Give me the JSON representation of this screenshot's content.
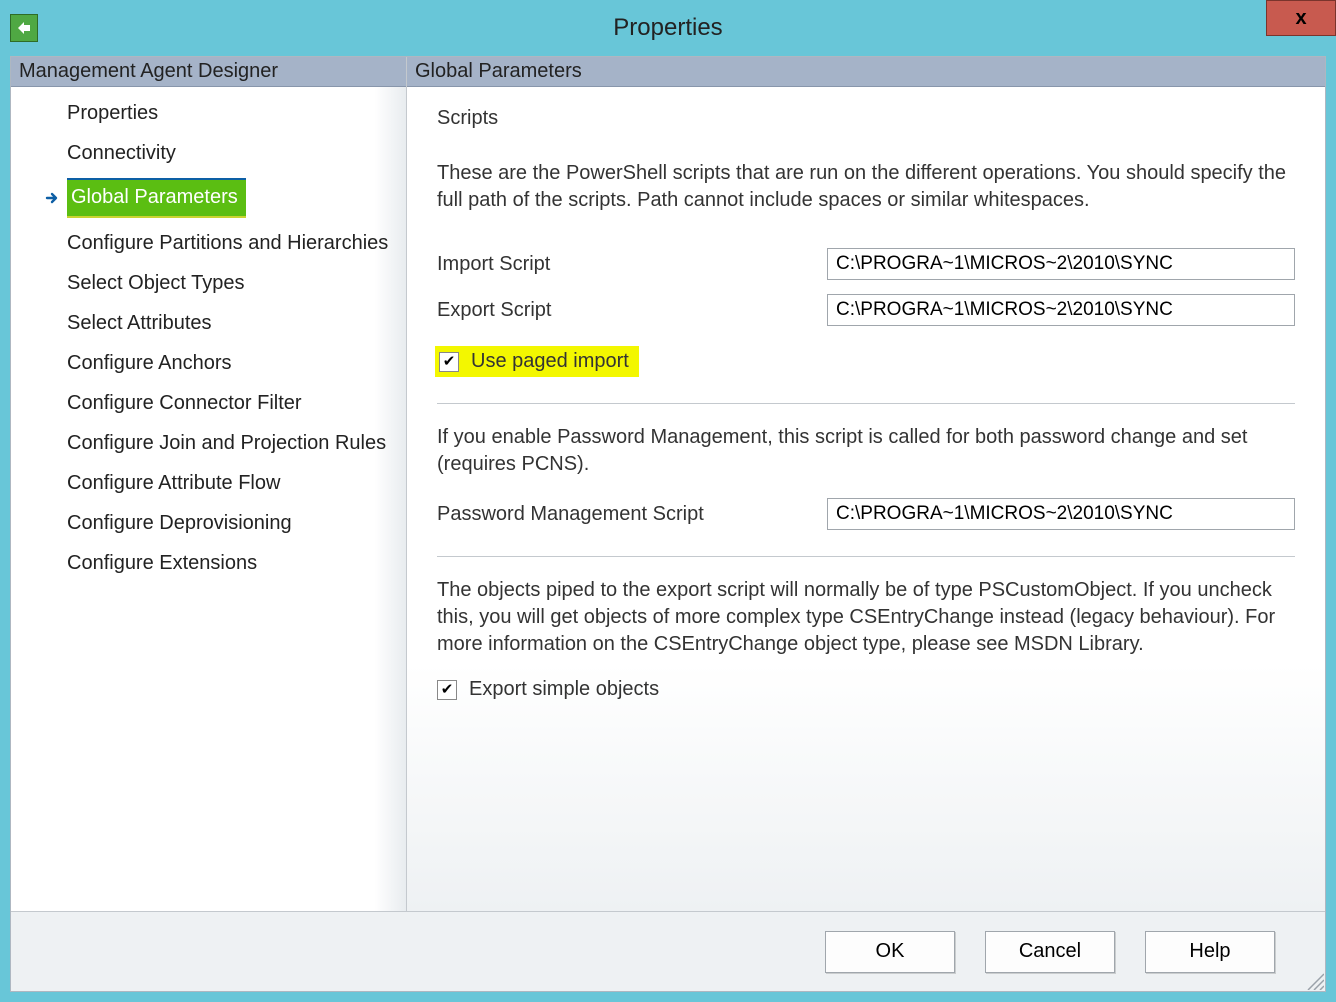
{
  "window": {
    "title": "Properties",
    "close_glyph": "x"
  },
  "left": {
    "header": "Management Agent Designer",
    "items": [
      {
        "label": "Properties",
        "selected": false
      },
      {
        "label": "Connectivity",
        "selected": false
      },
      {
        "label": "Global Parameters",
        "selected": true
      },
      {
        "label": "Configure Partitions and Hierarchies",
        "selected": false
      },
      {
        "label": "Select Object Types",
        "selected": false
      },
      {
        "label": "Select Attributes",
        "selected": false
      },
      {
        "label": "Configure Anchors",
        "selected": false
      },
      {
        "label": "Configure Connector Filter",
        "selected": false
      },
      {
        "label": "Configure Join and Projection Rules",
        "selected": false
      },
      {
        "label": "Configure Attribute Flow",
        "selected": false
      },
      {
        "label": "Configure Deprovisioning",
        "selected": false
      },
      {
        "label": "Configure Extensions",
        "selected": false
      }
    ]
  },
  "right": {
    "header": "Global Parameters",
    "scripts_title": "Scripts",
    "scripts_desc": "These are the PowerShell scripts that are run on the different operations. You should specify the full path of the scripts. Path cannot include spaces or similar whitespaces.",
    "import_label": "Import Script",
    "import_value": "C:\\PROGRA~1\\MICROS~2\\2010\\SYNC",
    "export_label": "Export Script",
    "export_value": "C:\\PROGRA~1\\MICROS~2\\2010\\SYNC",
    "use_paged_label": "Use paged import",
    "pw_desc": "If you enable Password Management, this script is called for both password change and set (requires PCNS).",
    "pw_label": "Password Management Script",
    "pw_value": "C:\\PROGRA~1\\MICROS~2\\2010\\SYNC",
    "export_obj_desc": "The objects piped to the export script will normally be of type PSCustomObject. If you uncheck this, you will get objects of more complex type CSEntryChange instead (legacy behaviour). For more information on the CSEntryChange object type, please see MSDN Library.",
    "export_simple_label": "Export simple objects"
  },
  "footer": {
    "ok": "OK",
    "cancel": "Cancel",
    "help": "Help"
  }
}
